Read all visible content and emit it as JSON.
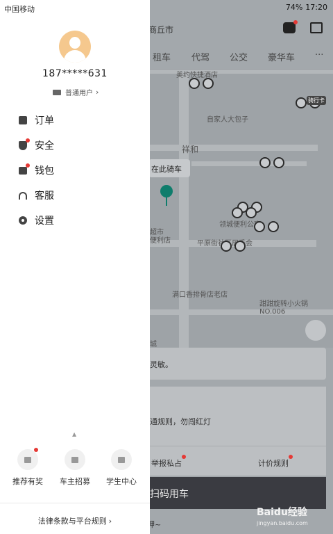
{
  "status_bar": {
    "carrier": "中国移动",
    "battery": "74%",
    "time": "17:20"
  },
  "drawer": {
    "phone": "187*****631",
    "user_type": "普通用户",
    "menu": [
      {
        "label": "订单",
        "icon": "order-icon",
        "dot": false
      },
      {
        "label": "安全",
        "icon": "shield-icon",
        "dot": true
      },
      {
        "label": "钱包",
        "icon": "wallet-icon",
        "dot": true
      },
      {
        "label": "客服",
        "icon": "headset-icon",
        "dot": false
      },
      {
        "label": "设置",
        "icon": "gear-icon",
        "dot": false
      }
    ],
    "quick_links": [
      {
        "label": "推荐有奖",
        "icon": "gift-icon",
        "dot": true
      },
      {
        "label": "车主招募",
        "icon": "driver-icon",
        "dot": false
      },
      {
        "label": "学生中心",
        "icon": "graduation-cap-icon",
        "dot": false
      }
    ],
    "legal": "法律条款与平台规则"
  },
  "background": {
    "city": "商丘市",
    "tabs": [
      "租车",
      "代驾",
      "公交",
      "豪华车",
      "···"
    ],
    "callout": "在此骑车",
    "bike_card_badge": "骑行卡",
    "map_labels": [
      "美约快捷酒店",
      "自家人大包子",
      "祥和",
      "领城便利公寓",
      "平原街社区居委会",
      "满口香排骨店老店",
      "甜甜旋转小火锅NO.006",
      "超市",
      "便利店",
      "城"
    ],
    "card1_text": "灵敏。",
    "card2_text": "通规则，勿闯红灯",
    "report_label": "举报私占",
    "pricing_label": "计价规则",
    "scan_label": "扫码用车",
    "bottom_text": "呷~",
    "watermark": "Baidu经验",
    "watermark_sub": "jingyan.baidu.com"
  }
}
